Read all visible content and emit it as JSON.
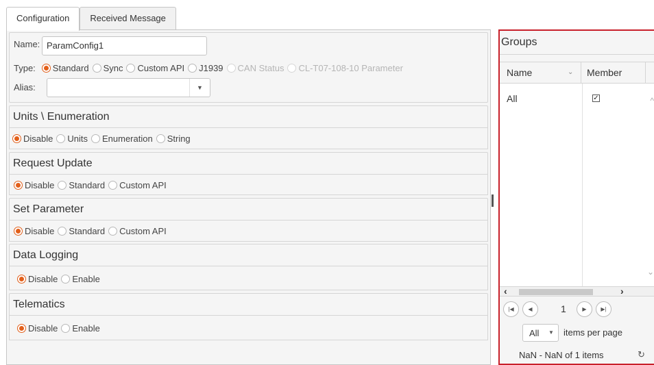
{
  "tabs": [
    {
      "label": "Configuration",
      "active": true
    },
    {
      "label": "Received Message",
      "active": false
    }
  ],
  "config": {
    "name_label": "Name:",
    "name_value": "ParamConfig1",
    "type_label": "Type:",
    "type_options": [
      "Standard",
      "Sync",
      "Custom API",
      "J1939",
      "CAN Status",
      "CL-T07-108-10 Parameter"
    ],
    "type_selected": "Standard",
    "alias_label": "Alias:",
    "alias_value": ""
  },
  "sections": {
    "units": {
      "title": "Units \\ Enumeration",
      "options": [
        "Disable",
        "Units",
        "Enumeration",
        "String"
      ],
      "selected": "Disable"
    },
    "request": {
      "title": "Request Update",
      "options": [
        "Disable",
        "Standard",
        "Custom API"
      ],
      "selected": "Disable"
    },
    "setparam": {
      "title": "Set Parameter",
      "options": [
        "Disable",
        "Standard",
        "Custom API"
      ],
      "selected": "Disable"
    },
    "logging": {
      "title": "Data Logging",
      "options": [
        "Disable",
        "Enable"
      ],
      "selected": "Disable"
    },
    "telematics": {
      "title": "Telematics",
      "options": [
        "Disable",
        "Enable"
      ],
      "selected": "Disable"
    }
  },
  "groups": {
    "title": "Groups",
    "columns": {
      "name": "Name",
      "member": "Member"
    },
    "rows": [
      {
        "name": "All",
        "member": true
      }
    ],
    "pager": {
      "page": "1",
      "page_size": "All",
      "items_per_page_label": "items per page",
      "info": "NaN - NaN of 1 items"
    }
  },
  "colors": {
    "accent": "#e25f1a",
    "highlight_border": "#c8202a"
  }
}
